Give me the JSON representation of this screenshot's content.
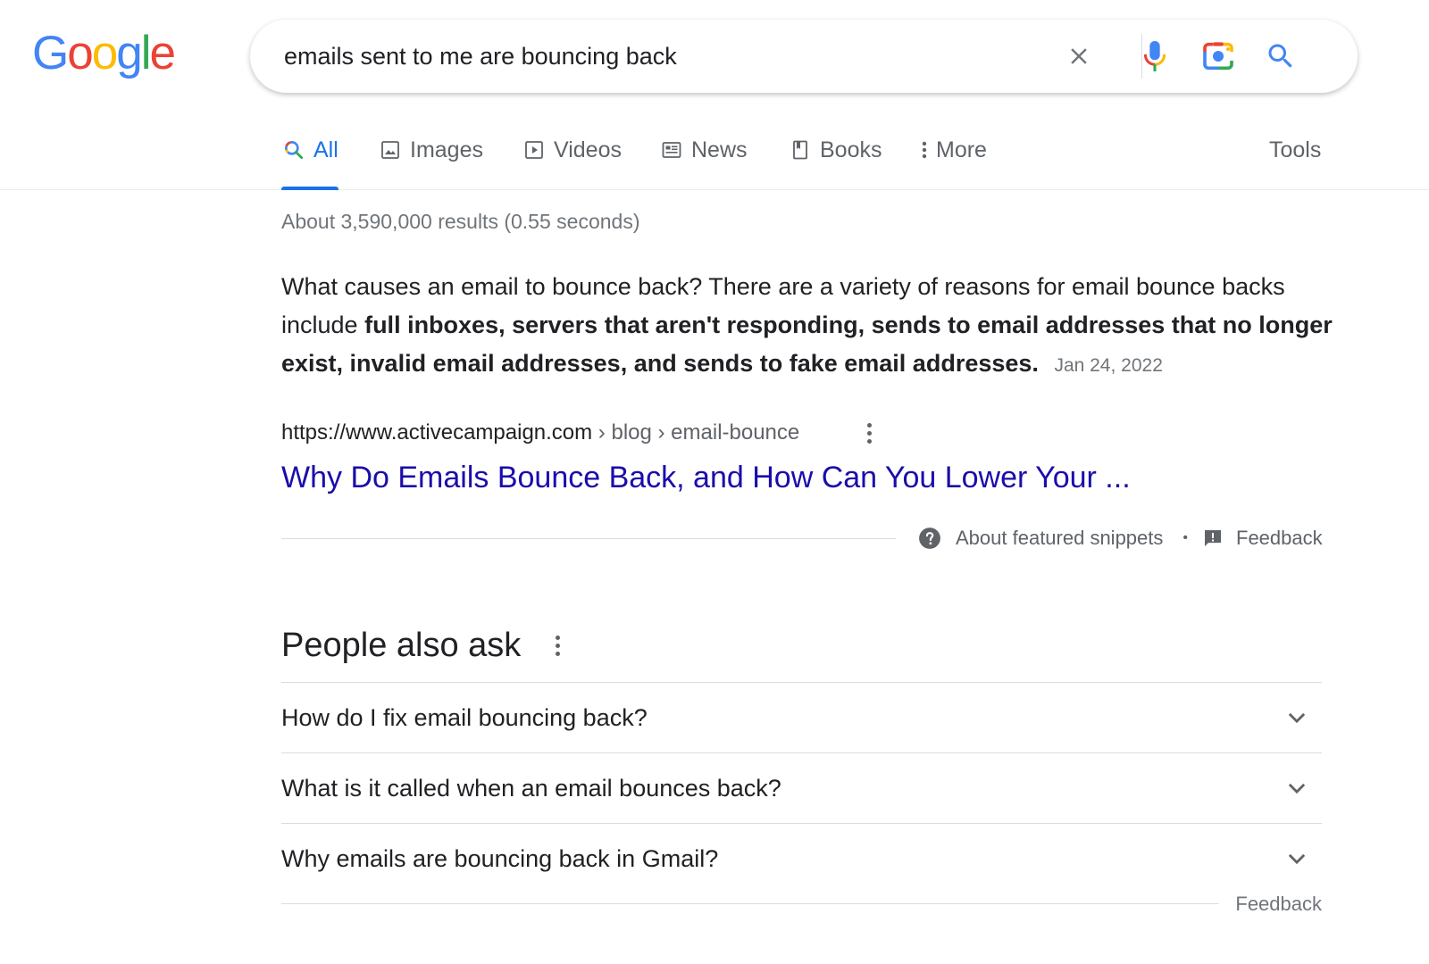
{
  "logo": {
    "letters": [
      {
        "char": "G",
        "color": "#4285F4"
      },
      {
        "char": "o",
        "color": "#EA4335"
      },
      {
        "char": "o",
        "color": "#FBBC05"
      },
      {
        "char": "g",
        "color": "#4285F4"
      },
      {
        "char": "l",
        "color": "#34A853"
      },
      {
        "char": "e",
        "color": "#EA4335"
      }
    ]
  },
  "search": {
    "query": "emails sent to me are bouncing back",
    "icons": [
      "clear-icon",
      "microphone-icon",
      "camera-lens-icon",
      "search-icon"
    ]
  },
  "tabs": [
    {
      "label": "All",
      "icon": "search-icon",
      "active": true
    },
    {
      "label": "Images",
      "icon": "image-icon",
      "active": false
    },
    {
      "label": "Videos",
      "icon": "play-icon",
      "active": false
    },
    {
      "label": "News",
      "icon": "newspaper-icon",
      "active": false
    },
    {
      "label": "Books",
      "icon": "bookmark-icon",
      "active": false
    },
    {
      "label": "More",
      "icon": "dots-vertical-icon",
      "active": false
    }
  ],
  "tools_label": "Tools",
  "result_stats": "About 3,590,000 results (0.55 seconds)",
  "featured_snippet": {
    "text_plain": "What causes an email to bounce back? There are a variety of reasons for email bounce backs include ",
    "text_bold": "full inboxes, servers that aren't responding, sends to email addresses that no longer exist, invalid email addresses, and sends to fake email addresses",
    "text_end": ".",
    "date": "Jan 24, 2022",
    "cite_domain": "https://www.activecampaign.com",
    "cite_path": " › blog › email-bounce",
    "title": "Why Do Emails Bounce Back, and How Can You Lower Your ...",
    "about_label": "About featured snippets",
    "separator": "•",
    "feedback_label": "Feedback"
  },
  "people_also_ask": {
    "title": "People also ask",
    "questions": [
      "How do I fix email bouncing back?",
      "What is it called when an email bounces back?",
      "Why emails are bouncing back in Gmail?"
    ],
    "feedback_label": "Feedback"
  },
  "colors": {
    "link": "#1a0dab",
    "accent": "#1a73e8",
    "text": "#202124",
    "secondary": "#5f6368",
    "muted": "#70757a"
  }
}
